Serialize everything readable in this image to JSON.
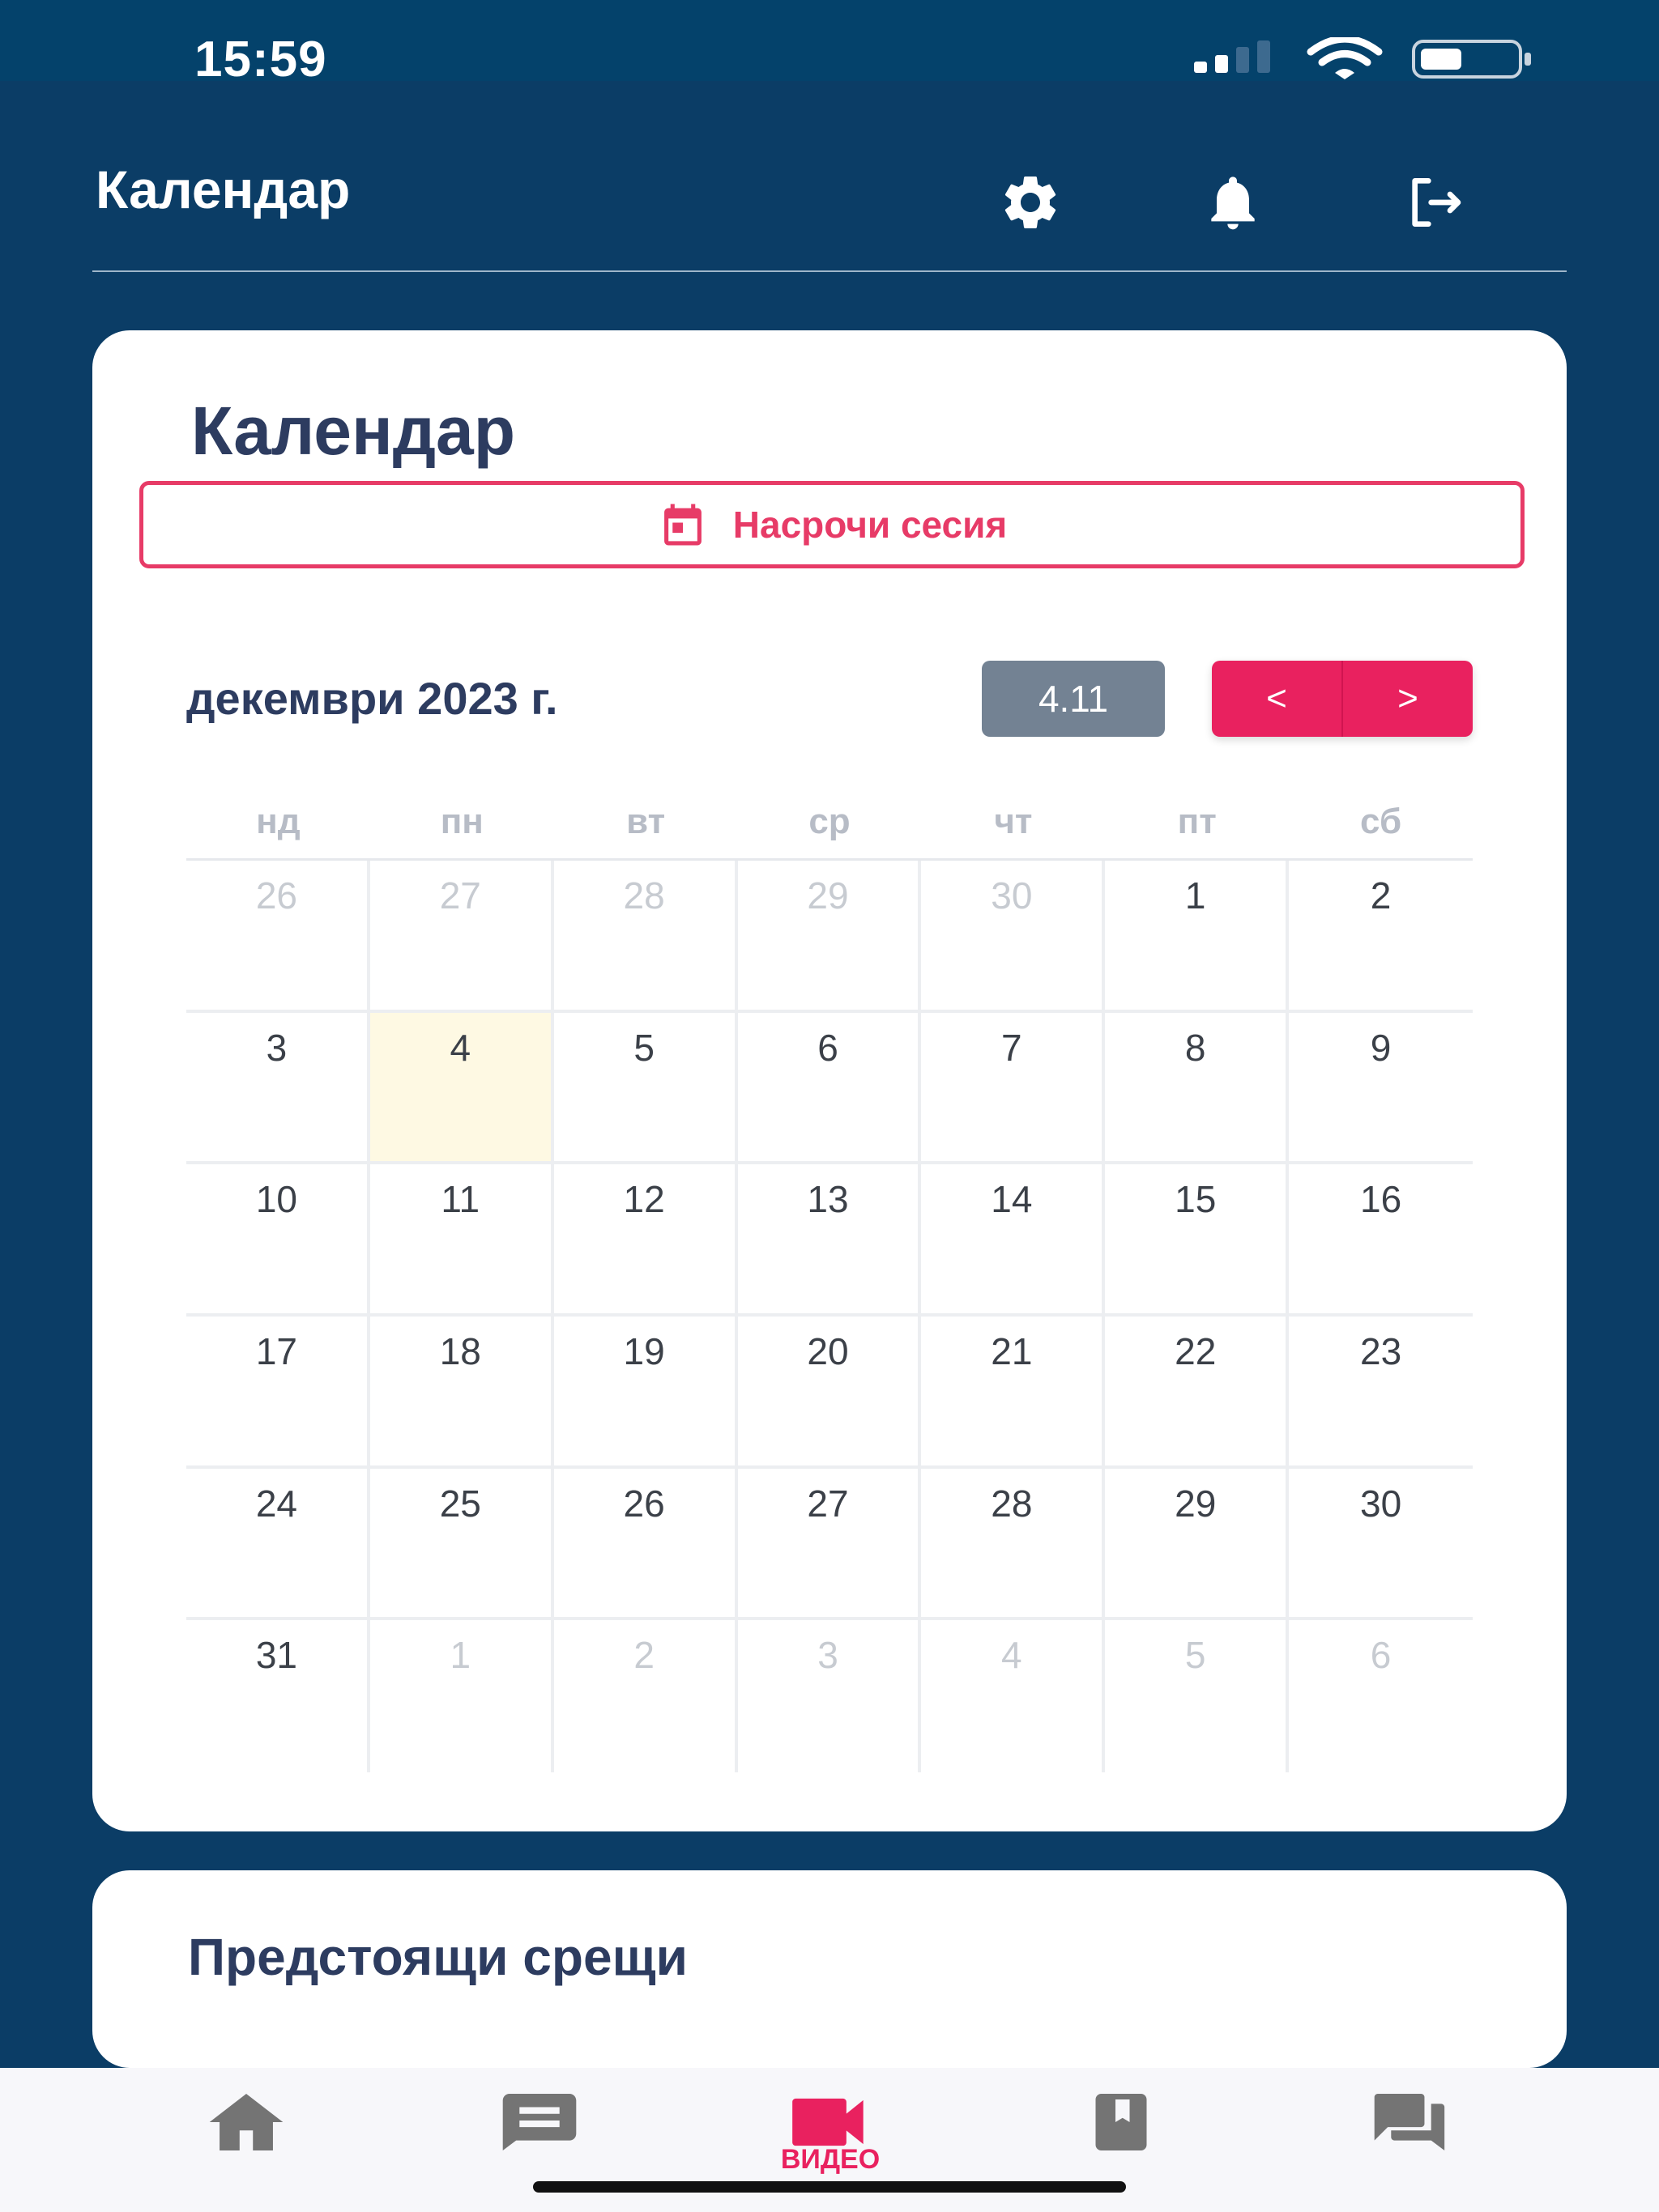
{
  "status_bar": {
    "time": "15:59"
  },
  "header": {
    "title": "Календар",
    "icons": [
      "gear-icon",
      "bell-icon",
      "logout-icon"
    ]
  },
  "calendar_card": {
    "title": "Календар",
    "schedule_button": "Насрочи сесия",
    "month_label": "декември 2023 г.",
    "today_button": "4.11",
    "prev_button": "<",
    "next_button": ">",
    "weekdays": [
      "нд",
      "пн",
      "вт",
      "ср",
      "чт",
      "пт",
      "сб"
    ],
    "days": [
      "26",
      "27",
      "28",
      "29",
      "30",
      "1",
      "2",
      "3",
      "4",
      "5",
      "6",
      "7",
      "8",
      "9",
      "10",
      "11",
      "12",
      "13",
      "14",
      "15",
      "16",
      "17",
      "18",
      "19",
      "20",
      "21",
      "22",
      "23",
      "24",
      "25",
      "26",
      "27",
      "28",
      "29",
      "30",
      "31",
      "1",
      "2",
      "3",
      "4",
      "5",
      "6"
    ],
    "today_day": "4"
  },
  "upcoming_card": {
    "title": "Предстоящи срещи"
  },
  "bottom_nav": {
    "items": [
      {
        "icon": "home-icon",
        "label": ""
      },
      {
        "icon": "message-icon",
        "label": ""
      },
      {
        "icon": "video-icon",
        "label": "ВИДЕО"
      },
      {
        "icon": "book-icon",
        "label": ""
      },
      {
        "icon": "chat-icon",
        "label": ""
      }
    ],
    "active_color": "#e9215f",
    "inactive_color": "#747474"
  },
  "colors": {
    "background": "#0b3d66",
    "accent": "#e9215f",
    "heading": "#2d3c60",
    "today_highlight": "#fef9e3"
  }
}
